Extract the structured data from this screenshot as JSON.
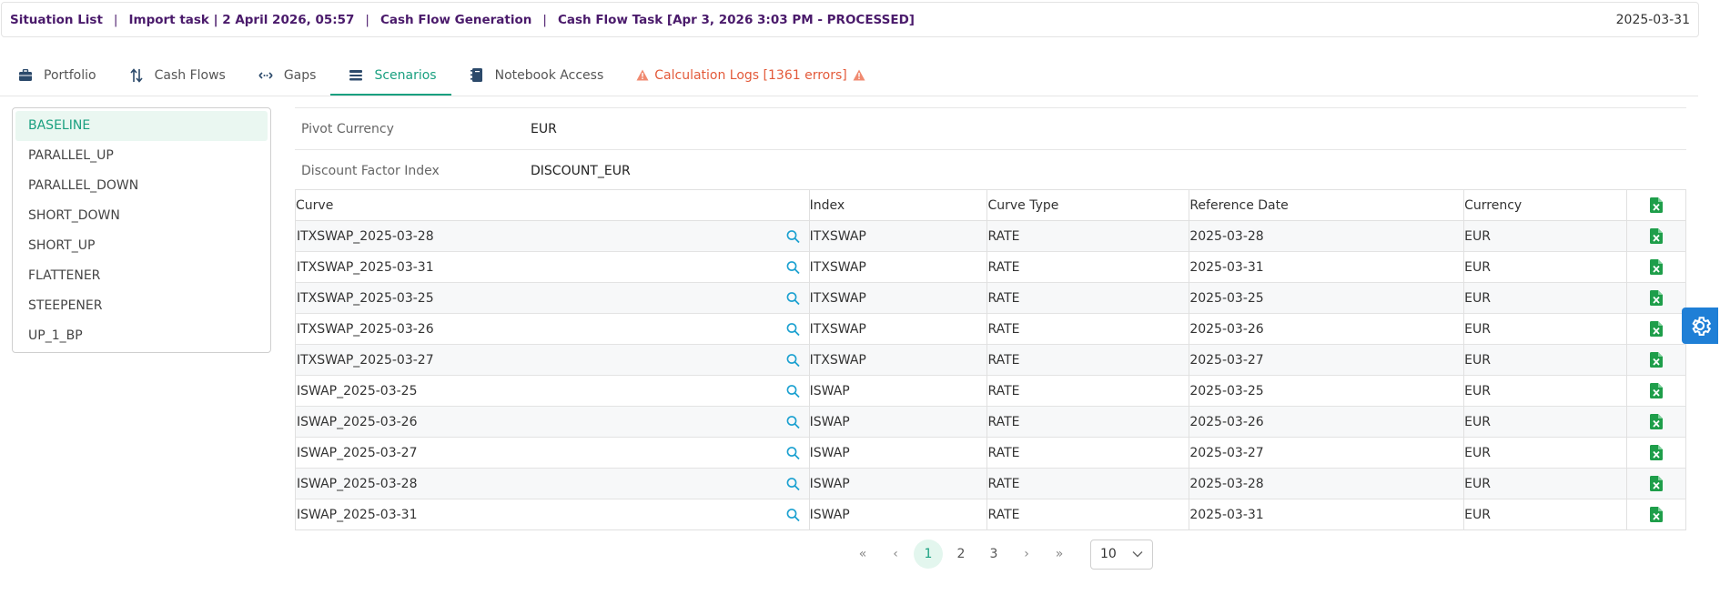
{
  "breadcrumb": {
    "items": [
      "Situation List",
      "Import task | 2 April 2026, 05:57",
      "Cash Flow Generation",
      "Cash Flow Task [Apr 3, 2026 3:03 PM - PROCESSED]"
    ],
    "separator": "|",
    "date": "2025-03-31"
  },
  "tabs": [
    {
      "label": "Portfolio",
      "icon": "briefcase-icon"
    },
    {
      "label": "Cash Flows",
      "icon": "sort-arrows-icon"
    },
    {
      "label": "Gaps",
      "icon": "gap-arrows-icon"
    },
    {
      "label": "Scenarios",
      "icon": "layers-icon",
      "active": true
    },
    {
      "label": "Notebook Access",
      "icon": "notebook-icon"
    },
    {
      "label": "Calculation Logs [1361 errors]",
      "icon": "warning-icon",
      "error": true
    }
  ],
  "scenarios": [
    "BASELINE",
    "PARALLEL_UP",
    "PARALLEL_DOWN",
    "SHORT_DOWN",
    "SHORT_UP",
    "FLATTENER",
    "STEEPENER",
    "UP_1_BP"
  ],
  "selected_scenario": "BASELINE",
  "properties": {
    "pivot_currency": {
      "label": "Pivot Currency",
      "value": "EUR"
    },
    "discount_factor_index": {
      "label": "Discount Factor Index",
      "value": "DISCOUNT_EUR"
    }
  },
  "table": {
    "headers": {
      "curve": "Curve",
      "index": "Index",
      "curve_type": "Curve Type",
      "reference_date": "Reference Date",
      "currency": "Currency"
    },
    "rows": [
      {
        "curve": "ITXSWAP_2025-03-28",
        "index": "ITXSWAP",
        "curve_type": "RATE",
        "reference_date": "2025-03-28",
        "currency": "EUR"
      },
      {
        "curve": "ITXSWAP_2025-03-31",
        "index": "ITXSWAP",
        "curve_type": "RATE",
        "reference_date": "2025-03-31",
        "currency": "EUR"
      },
      {
        "curve": "ITXSWAP_2025-03-25",
        "index": "ITXSWAP",
        "curve_type": "RATE",
        "reference_date": "2025-03-25",
        "currency": "EUR"
      },
      {
        "curve": "ITXSWAP_2025-03-26",
        "index": "ITXSWAP",
        "curve_type": "RATE",
        "reference_date": "2025-03-26",
        "currency": "EUR"
      },
      {
        "curve": "ITXSWAP_2025-03-27",
        "index": "ITXSWAP",
        "curve_type": "RATE",
        "reference_date": "2025-03-27",
        "currency": "EUR"
      },
      {
        "curve": "ISWAP_2025-03-25",
        "index": "ISWAP",
        "curve_type": "RATE",
        "reference_date": "2025-03-25",
        "currency": "EUR"
      },
      {
        "curve": "ISWAP_2025-03-26",
        "index": "ISWAP",
        "curve_type": "RATE",
        "reference_date": "2025-03-26",
        "currency": "EUR"
      },
      {
        "curve": "ISWAP_2025-03-27",
        "index": "ISWAP",
        "curve_type": "RATE",
        "reference_date": "2025-03-27",
        "currency": "EUR"
      },
      {
        "curve": "ISWAP_2025-03-28",
        "index": "ISWAP",
        "curve_type": "RATE",
        "reference_date": "2025-03-28",
        "currency": "EUR"
      },
      {
        "curve": "ISWAP_2025-03-31",
        "index": "ISWAP",
        "curve_type": "RATE",
        "reference_date": "2025-03-31",
        "currency": "EUR"
      }
    ]
  },
  "pagination": {
    "first": "«",
    "prev": "‹",
    "pages": [
      "1",
      "2",
      "3"
    ],
    "current": "1",
    "next": "›",
    "last": "»",
    "page_size": "10"
  },
  "colors": {
    "breadcrumb": "#4a1a6b",
    "accent": "#1aa080",
    "error": "#e35a3a",
    "excel": "#1e9e4a",
    "search": "#1aa0d0",
    "gear_fab": "#1f7fd6"
  }
}
